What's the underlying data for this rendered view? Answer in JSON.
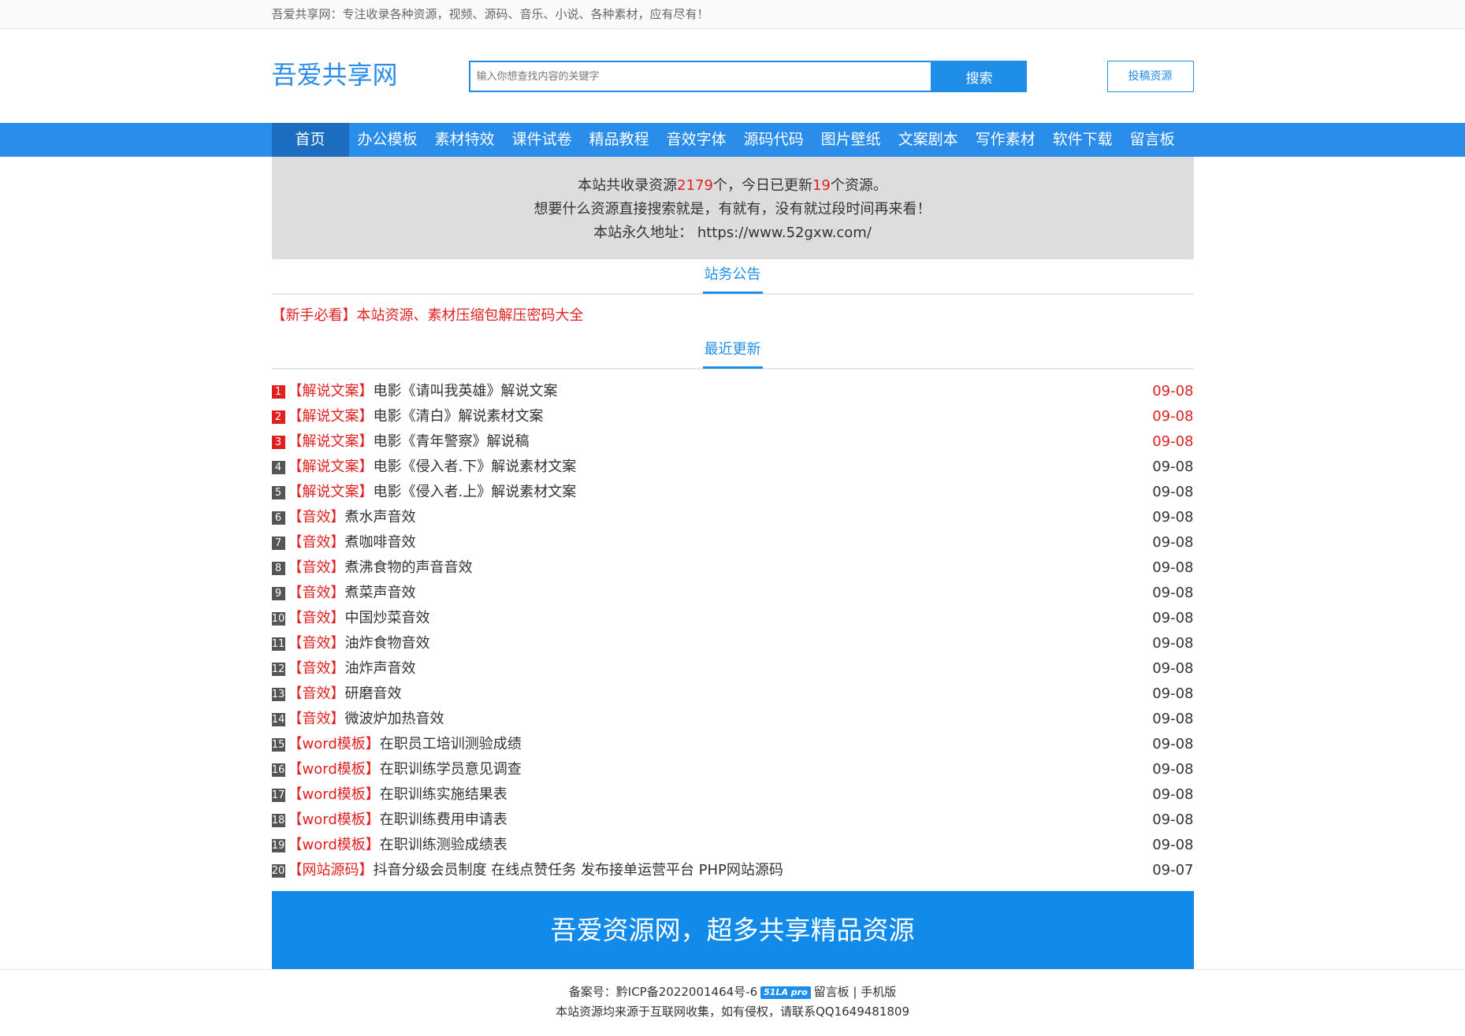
{
  "topbar": {
    "text": "吾爱共享网：专注收录各种资源，视频、源码、音乐、小说、各种素材，应有尽有！"
  },
  "header": {
    "logo": "吾爱共享网",
    "search_placeholder": "输入你想查找内容的关键字",
    "search_button": "搜索",
    "submit_button": "投稿资源"
  },
  "nav": [
    {
      "label": "首页"
    },
    {
      "label": "办公模板"
    },
    {
      "label": "素材特效"
    },
    {
      "label": "课件试卷"
    },
    {
      "label": "精品教程"
    },
    {
      "label": "音效字体"
    },
    {
      "label": "源码代码"
    },
    {
      "label": "图片壁纸"
    },
    {
      "label": "文案剧本"
    },
    {
      "label": "写作素材"
    },
    {
      "label": "软件下载"
    },
    {
      "label": "留言板"
    }
  ],
  "info": {
    "line1_prefix": "本站共收录资源",
    "total": "2179",
    "line1_mid": "个，今日已更新",
    "today": "19",
    "line1_suffix": "个资源。",
    "line2": "想要什么资源直接搜索就是，有就有，没有就过段时间再来看！",
    "line3_label": "本站永久地址：",
    "line3_url": "https://www.52gxw.com/"
  },
  "notice_section": {
    "heading": "站务公告",
    "item": "【新手必看】本站资源、素材压缩包解压密码大全"
  },
  "recent_section": {
    "heading": "最近更新",
    "items": [
      {
        "num": "1",
        "tag": "【解说文案】",
        "title": "电影《请叫我英雄》解说文案",
        "date": "09-08"
      },
      {
        "num": "2",
        "tag": "【解说文案】",
        "title": "电影《清白》解说素材文案",
        "date": "09-08"
      },
      {
        "num": "3",
        "tag": "【解说文案】",
        "title": "电影《青年警察》解说稿",
        "date": "09-08"
      },
      {
        "num": "4",
        "tag": "【解说文案】",
        "title": "电影《侵入者.下》解说素材文案",
        "date": "09-08"
      },
      {
        "num": "5",
        "tag": "【解说文案】",
        "title": "电影《侵入者.上》解说素材文案",
        "date": "09-08"
      },
      {
        "num": "6",
        "tag": "【音效】",
        "title": "煮水声音效",
        "date": "09-08"
      },
      {
        "num": "7",
        "tag": "【音效】",
        "title": "煮咖啡音效",
        "date": "09-08"
      },
      {
        "num": "8",
        "tag": "【音效】",
        "title": "煮沸食物的声音音效",
        "date": "09-08"
      },
      {
        "num": "9",
        "tag": "【音效】",
        "title": "煮菜声音效",
        "date": "09-08"
      },
      {
        "num": "10",
        "tag": "【音效】",
        "title": "中国炒菜音效",
        "date": "09-08"
      },
      {
        "num": "11",
        "tag": "【音效】",
        "title": "油炸食物音效",
        "date": "09-08"
      },
      {
        "num": "12",
        "tag": "【音效】",
        "title": "油炸声音效",
        "date": "09-08"
      },
      {
        "num": "13",
        "tag": "【音效】",
        "title": "研磨音效",
        "date": "09-08"
      },
      {
        "num": "14",
        "tag": "【音效】",
        "title": "微波炉加热音效",
        "date": "09-08"
      },
      {
        "num": "15",
        "tag": "【word模板】",
        "title": "在职员工培训测验成绩",
        "date": "09-08"
      },
      {
        "num": "16",
        "tag": "【word模板】",
        "title": "在职训练学员意见调查",
        "date": "09-08"
      },
      {
        "num": "17",
        "tag": "【word模板】",
        "title": "在职训练实施结果表",
        "date": "09-08"
      },
      {
        "num": "18",
        "tag": "【word模板】",
        "title": "在职训练费用申请表",
        "date": "09-08"
      },
      {
        "num": "19",
        "tag": "【word模板】",
        "title": "在职训练测验成绩表",
        "date": "09-08"
      },
      {
        "num": "20",
        "tag": "【网站源码】",
        "title": "抖音分级会员制度 在线点赞任务 发布接单运营平台 PHP网站源码",
        "date": "09-07"
      }
    ]
  },
  "banner": {
    "text": "吾爱资源网，超多共享精品资源"
  },
  "footer": {
    "icp_label": "备案号：",
    "icp": "黔ICP备2022001464号-6",
    "badge": "51LA pro",
    "links": "留言板 | 手机版",
    "disclaimer": "本站资源均来源于互联网收集，如有侵权，请联系QQ1649481809"
  },
  "colors": {
    "accent": "#2a8de9",
    "nav_active": "#1c6dc0",
    "highlight": "#e02020",
    "banner": "#118ae9",
    "info_bg": "#dddddd"
  }
}
